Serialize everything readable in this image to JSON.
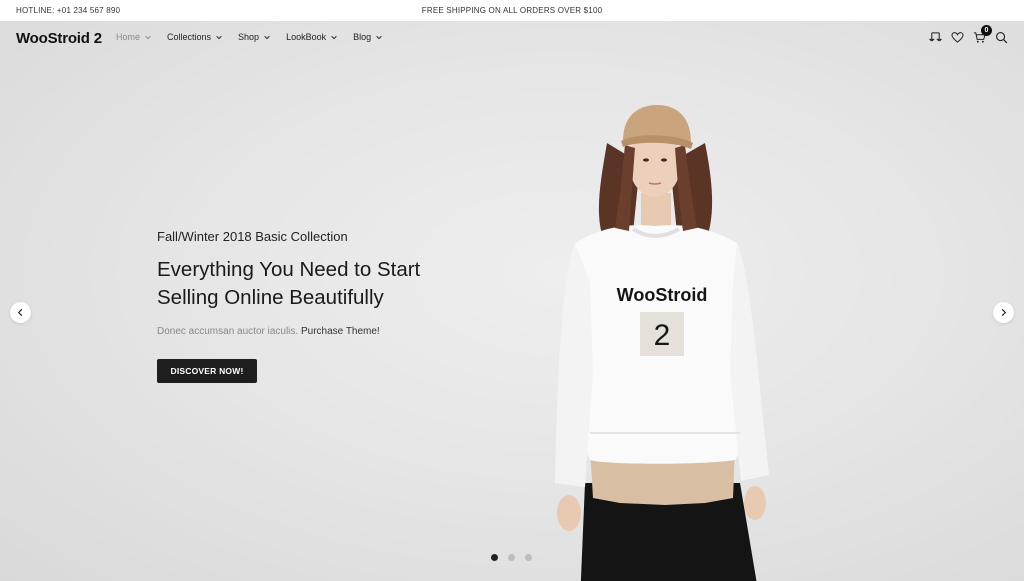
{
  "topbar": {
    "hotline": "HOTLINE: +01 234 567 890",
    "shipping": "FREE SHIPPING ON ALL ORDERS OVER $100"
  },
  "header": {
    "logo": "WooStroid 2",
    "nav": [
      {
        "label": "Home",
        "active": true
      },
      {
        "label": "Collections"
      },
      {
        "label": "Shop"
      },
      {
        "label": "LookBook"
      },
      {
        "label": "Blog"
      }
    ],
    "icons": [
      "compare-icon",
      "heart-icon",
      "cart-icon",
      "search-icon"
    ],
    "cart_count": "0"
  },
  "hero": {
    "subtitle": "Fall/Winter 2018 Basic Collection",
    "headline_line1": "Everything You Need to Start",
    "headline_line2": "Selling Online Beautifully",
    "description": "Donec accumsan auctor iaculis.",
    "description_link": "Purchase Theme!",
    "cta_label": "DISCOVER NOW!",
    "shirt_brand": "WooStroid",
    "shirt_number": "2",
    "slides_total": 3,
    "slide_active": 1
  },
  "colors": {
    "accent": "#1e1e1e",
    "background": "#e4e4e4",
    "muted_text": "#888888"
  }
}
